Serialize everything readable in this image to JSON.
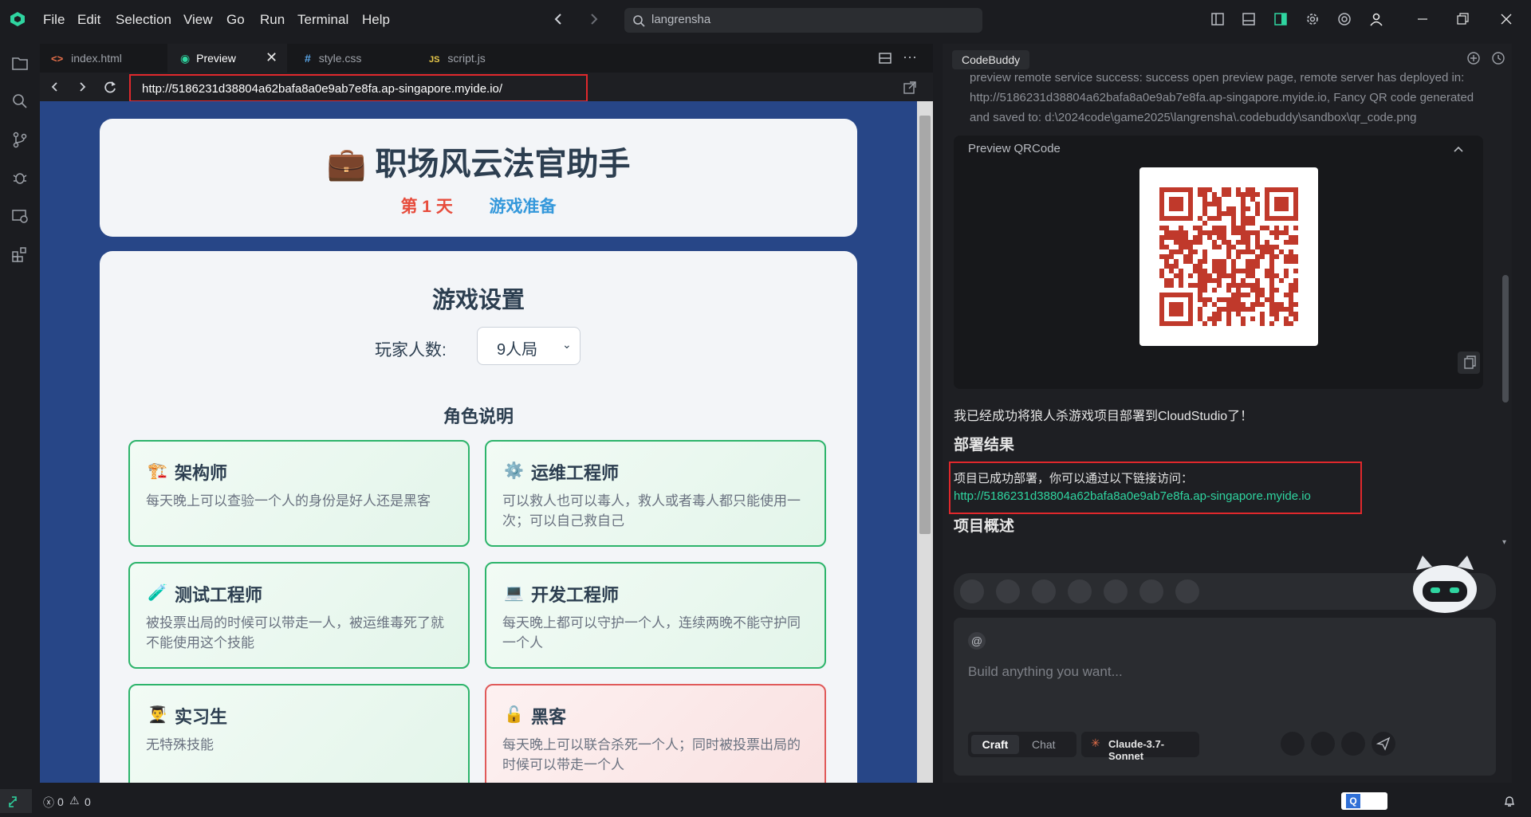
{
  "titlebar": {
    "menus": [
      "File",
      "Edit",
      "Selection",
      "View",
      "Go",
      "Run",
      "Terminal",
      "Help"
    ],
    "search_text": "langrensha"
  },
  "editor": {
    "tabs": [
      {
        "label": "index.html",
        "icon": "html-icon"
      },
      {
        "label": "Preview",
        "icon": "eye-icon"
      },
      {
        "label": "style.css",
        "icon": "css-icon"
      },
      {
        "label": "script.js",
        "icon": "js-icon"
      }
    ],
    "url": "http://5186231d38804a62bafa8a0e9ab7e8fa.ap-singapore.myide.io/"
  },
  "game": {
    "title": "职场风云法官助手",
    "day": "第 1 天",
    "phase": "游戏准备",
    "settings_title": "游戏设置",
    "player_label": "玩家人数:",
    "player_value": "9人局",
    "roles_title": "角色说明",
    "roles": [
      {
        "icon": "🏗️",
        "name": "架构师",
        "desc": "每天晚上可以查验一个人的身份是好人还是黑客"
      },
      {
        "icon": "⚙️",
        "name": "运维工程师",
        "desc": "可以救人也可以毒人，救人或者毒人都只能使用一次；可以自己救自己"
      },
      {
        "icon": "🧪",
        "name": "测试工程师",
        "desc": "被投票出局的时候可以带走一人，被运维毒死了就不能使用这个技能"
      },
      {
        "icon": "💻",
        "name": "开发工程师",
        "desc": "每天晚上都可以守护一个人，连续两晚不能守护同一个人"
      },
      {
        "icon": "👨‍🎓",
        "name": "实习生",
        "desc": "无特殊技能"
      },
      {
        "icon": "🔓",
        "name": "黑客",
        "desc": "每天晚上可以联合杀死一个人；同时被投票出局的时候可以带走一个人"
      }
    ]
  },
  "panel": {
    "title": "CodeBuddy",
    "log_line1": "preview remote service success: success open preview page, remote server has deployed in:",
    "log_line2": "http://5186231d38804a62bafa8a0e9ab7e8fa.ap-singapore.myide.io, Fancy QR code generated",
    "log_line3": "and saved to: d:\\2024code\\game2025\\langrensha\\.codebuddy\\sandbox\\qr_code.png",
    "qr_title": "Preview QRCode",
    "msg": "我已经成功将狼人杀游戏项目部署到CloudStudio了！",
    "heading_result": "部署结果",
    "deploy_text": "项目已成功部署，你可以通过以下链接访问：",
    "deploy_link": "http://5186231d38804a62bafa8a0e9ab7e8fa.ap-singapore.myide.io",
    "heading_overview": "项目概述",
    "input_at": "@",
    "input_placeholder": "Build anything you want...",
    "mode_craft": "Craft",
    "mode_chat": "Chat",
    "model": "Claude-3.7-Sonnet"
  },
  "status": {
    "errors": "0",
    "warnings": "0"
  },
  "colors": {
    "accent": "#2fd5a0",
    "highlight_box": "#e0282c",
    "day_red": "#e74c3c",
    "phase_blue": "#3498db"
  }
}
